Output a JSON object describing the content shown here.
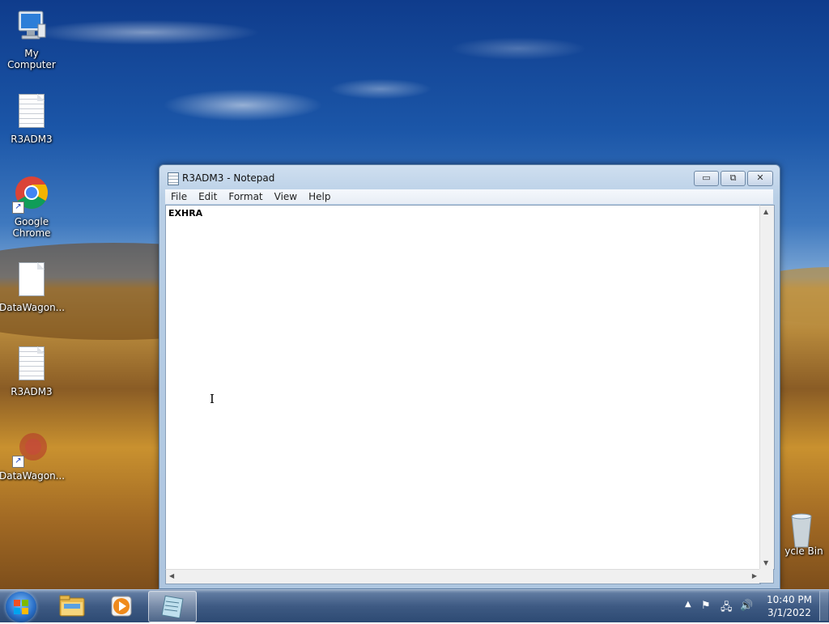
{
  "desktop": {
    "icons": [
      {
        "label": "My Computer",
        "icon": "computer-icon"
      },
      {
        "label": "R3ADM3",
        "icon": "text-file-icon"
      },
      {
        "label": "Google Chrome",
        "icon": "chrome-icon"
      },
      {
        "label": "DataWagon...",
        "icon": "blank-file-icon"
      },
      {
        "label": "R3ADM3",
        "icon": "text-file-icon"
      },
      {
        "label": "DataWagon...",
        "icon": "app-shortcut-icon"
      },
      {
        "label": "ycle Bin",
        "icon": "recycle-bin-icon"
      }
    ]
  },
  "notepad": {
    "title": "R3ADM3 - Notepad",
    "menu": [
      "File",
      "Edit",
      "Format",
      "View",
      "Help"
    ],
    "content": "EXHRA",
    "buttons": {
      "minimize": "▭",
      "maximize": "⧉",
      "close": "✕"
    }
  },
  "taskbar": {
    "apps": [
      {
        "name": "Windows Explorer",
        "icon": "folder-icon",
        "active": false
      },
      {
        "name": "Windows Media Player",
        "icon": "media-player-icon",
        "active": false
      },
      {
        "name": "Notepad",
        "icon": "notepad-icon",
        "active": true
      }
    ],
    "tray": {
      "time": "10:40 PM",
      "date": "3/1/2022",
      "icons": [
        "show-hidden-icon",
        "action-center-icon",
        "network-icon",
        "volume-icon"
      ]
    }
  }
}
